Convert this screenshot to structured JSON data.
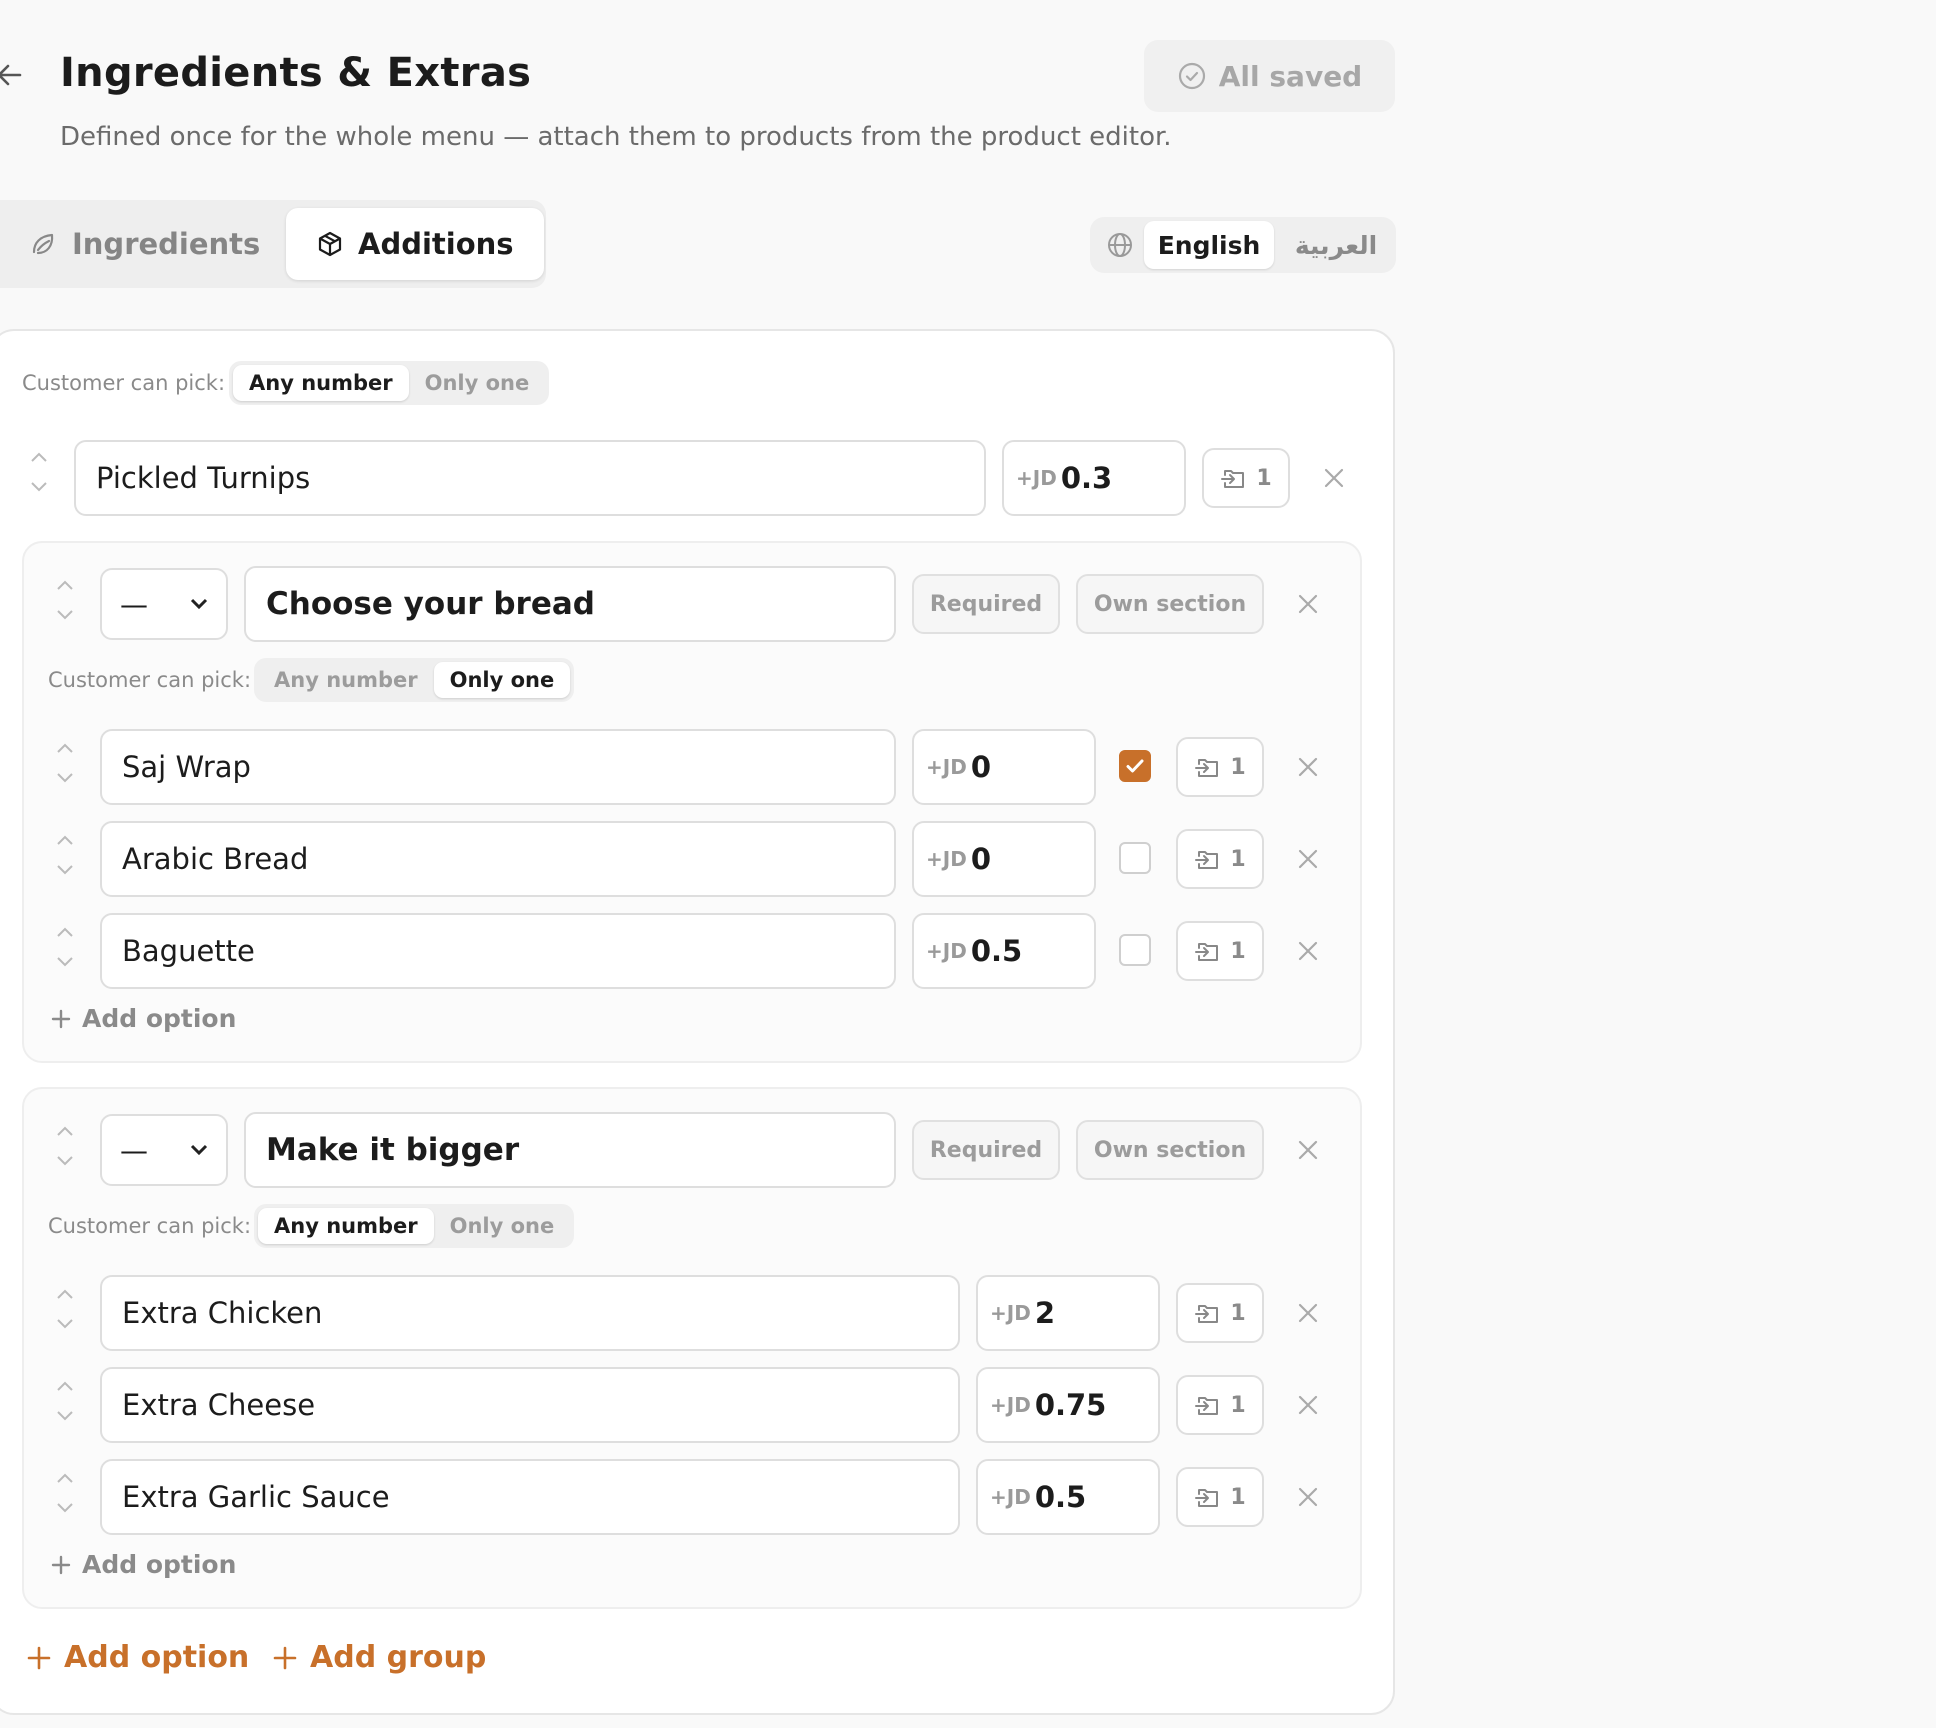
{
  "header": {
    "title": "Ingredients & Extras",
    "subtitle": "Defined once for the whole menu — attach them to products from the product editor.",
    "saved_status": "All saved"
  },
  "tabs": [
    {
      "label": "Ingredients",
      "icon": "leaf-icon",
      "active": false
    },
    {
      "label": "Additions",
      "icon": "package-icon",
      "active": true
    }
  ],
  "language": {
    "options": [
      "English",
      "العربية"
    ],
    "selected": "English"
  },
  "panel": {
    "pick_label": "Customer can pick:",
    "pick_options": [
      "Any number",
      "Only one"
    ],
    "pick_selected": "Any number",
    "top_item": {
      "name": "Pickled Turnips",
      "price_prefix": "+JD",
      "price": "0.3",
      "link_count": "1"
    },
    "groups": [
      {
        "select_value": "—",
        "title": "Choose your bread",
        "required_label": "Required",
        "own_section_label": "Own section",
        "pick_label": "Customer can pick:",
        "pick_options": [
          "Any number",
          "Only one"
        ],
        "pick_selected": "Only one",
        "options": [
          {
            "name": "Saj Wrap",
            "price_prefix": "+JD",
            "price": "0",
            "default": true,
            "link_count": "1"
          },
          {
            "name": "Arabic Bread",
            "price_prefix": "+JD",
            "price": "0",
            "default": false,
            "link_count": "1"
          },
          {
            "name": "Baguette",
            "price_prefix": "+JD",
            "price": "0.5",
            "default": false,
            "link_count": "1"
          }
        ],
        "add_option_label": "Add option"
      },
      {
        "select_value": "—",
        "title": "Make it bigger",
        "required_label": "Required",
        "own_section_label": "Own section",
        "pick_label": "Customer can pick:",
        "pick_options": [
          "Any number",
          "Only one"
        ],
        "pick_selected": "Any number",
        "options": [
          {
            "name": "Extra Chicken",
            "price_prefix": "+JD",
            "price": "2",
            "link_count": "1"
          },
          {
            "name": "Extra Cheese",
            "price_prefix": "+JD",
            "price": "0.75",
            "link_count": "1"
          },
          {
            "name": "Extra Garlic Sauce",
            "price_prefix": "+JD",
            "price": "0.5",
            "link_count": "1"
          }
        ],
        "add_option_label": "Add option"
      }
    ],
    "footer": {
      "add_option_label": "Add option",
      "add_group_label": "Add group"
    }
  },
  "colors": {
    "accent": "#c8702a",
    "muted": "#8a8a8a",
    "border": "#dedede"
  }
}
